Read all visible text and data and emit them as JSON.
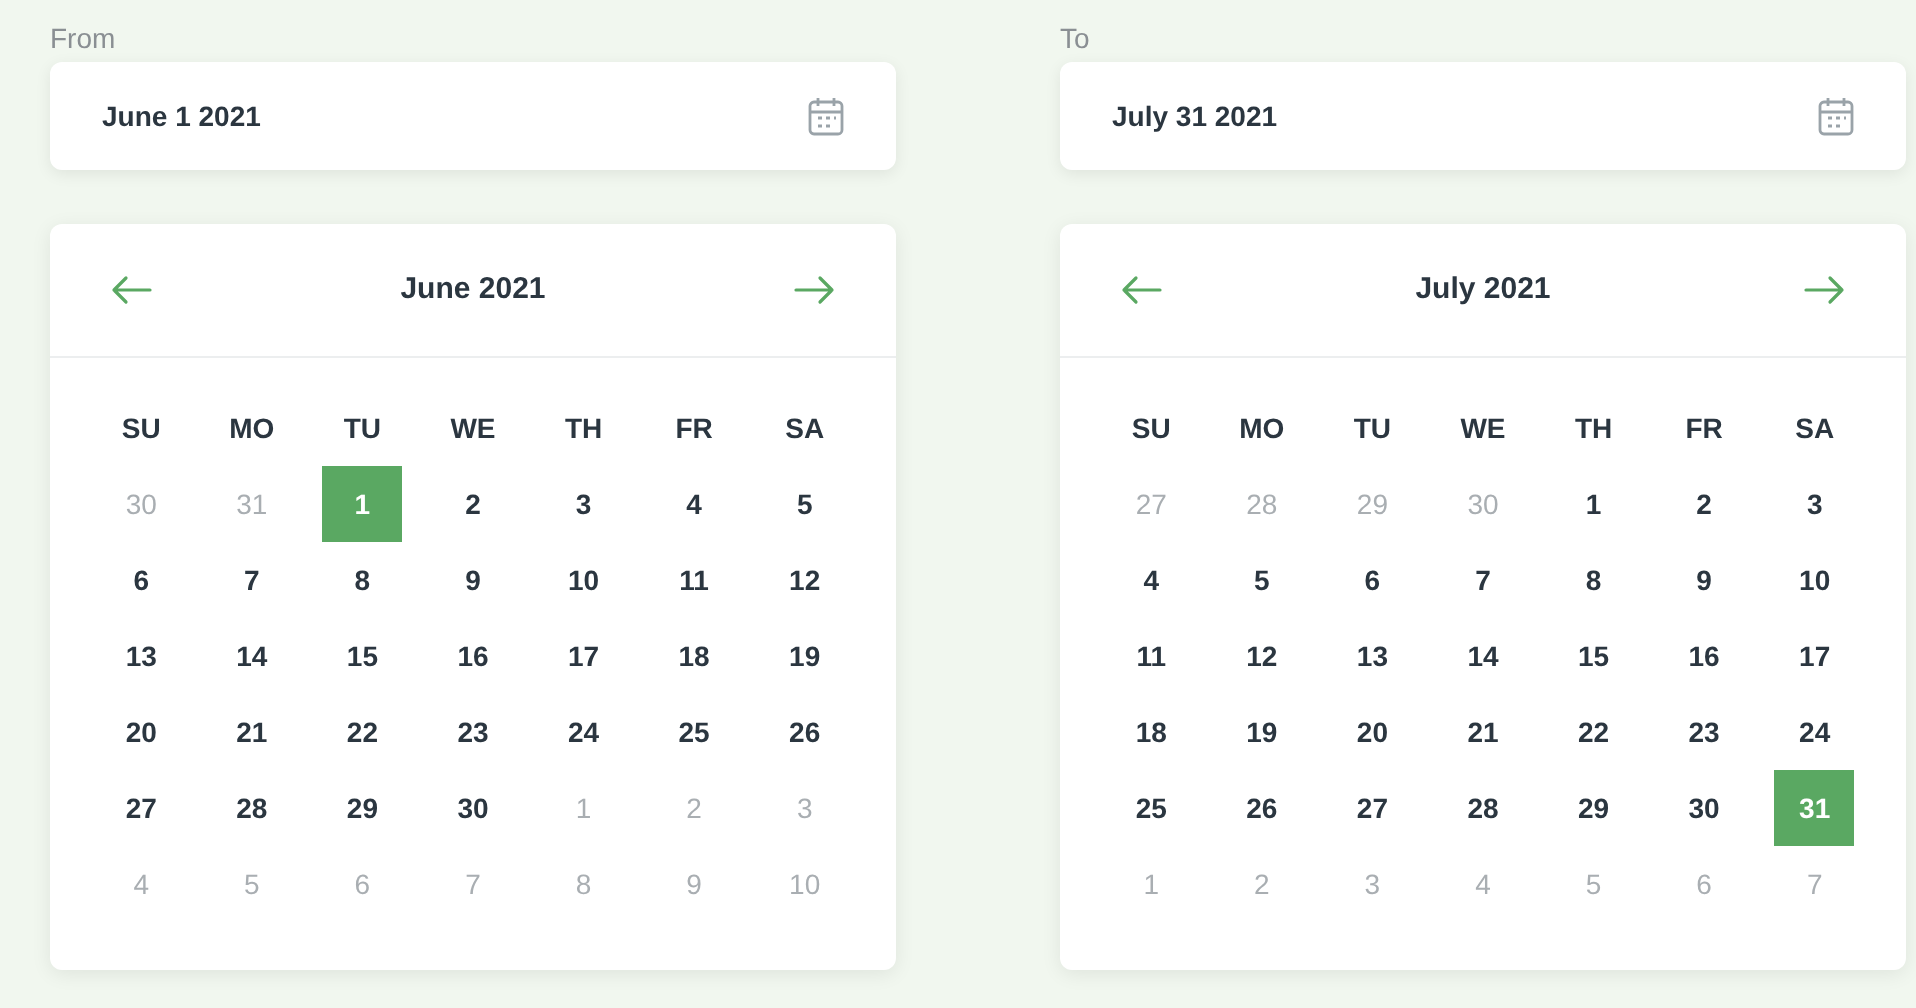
{
  "pickers": [
    {
      "label": "From",
      "value": "June 1 2021",
      "month": "June 2021",
      "weekdays": [
        "SU",
        "MO",
        "TU",
        "WE",
        "TH",
        "FR",
        "SA"
      ],
      "weeks": [
        [
          {
            "text": "30",
            "muted": true,
            "selected": false
          },
          {
            "text": "31",
            "muted": true,
            "selected": false
          },
          {
            "text": "1",
            "muted": false,
            "selected": true
          },
          {
            "text": "2",
            "muted": false,
            "selected": false
          },
          {
            "text": "3",
            "muted": false,
            "selected": false
          },
          {
            "text": "4",
            "muted": false,
            "selected": false
          },
          {
            "text": "5",
            "muted": false,
            "selected": false
          }
        ],
        [
          {
            "text": "6",
            "muted": false,
            "selected": false
          },
          {
            "text": "7",
            "muted": false,
            "selected": false
          },
          {
            "text": "8",
            "muted": false,
            "selected": false
          },
          {
            "text": "9",
            "muted": false,
            "selected": false
          },
          {
            "text": "10",
            "muted": false,
            "selected": false
          },
          {
            "text": "11",
            "muted": false,
            "selected": false
          },
          {
            "text": "12",
            "muted": false,
            "selected": false
          }
        ],
        [
          {
            "text": "13",
            "muted": false,
            "selected": false
          },
          {
            "text": "14",
            "muted": false,
            "selected": false
          },
          {
            "text": "15",
            "muted": false,
            "selected": false
          },
          {
            "text": "16",
            "muted": false,
            "selected": false
          },
          {
            "text": "17",
            "muted": false,
            "selected": false
          },
          {
            "text": "18",
            "muted": false,
            "selected": false
          },
          {
            "text": "19",
            "muted": false,
            "selected": false
          }
        ],
        [
          {
            "text": "20",
            "muted": false,
            "selected": false
          },
          {
            "text": "21",
            "muted": false,
            "selected": false
          },
          {
            "text": "22",
            "muted": false,
            "selected": false
          },
          {
            "text": "23",
            "muted": false,
            "selected": false
          },
          {
            "text": "24",
            "muted": false,
            "selected": false
          },
          {
            "text": "25",
            "muted": false,
            "selected": false
          },
          {
            "text": "26",
            "muted": false,
            "selected": false
          }
        ],
        [
          {
            "text": "27",
            "muted": false,
            "selected": false
          },
          {
            "text": "28",
            "muted": false,
            "selected": false
          },
          {
            "text": "29",
            "muted": false,
            "selected": false
          },
          {
            "text": "30",
            "muted": false,
            "selected": false
          },
          {
            "text": "1",
            "muted": true,
            "selected": false
          },
          {
            "text": "2",
            "muted": true,
            "selected": false
          },
          {
            "text": "3",
            "muted": true,
            "selected": false
          }
        ],
        [
          {
            "text": "4",
            "muted": true,
            "selected": false
          },
          {
            "text": "5",
            "muted": true,
            "selected": false
          },
          {
            "text": "6",
            "muted": true,
            "selected": false
          },
          {
            "text": "7",
            "muted": true,
            "selected": false
          },
          {
            "text": "8",
            "muted": true,
            "selected": false
          },
          {
            "text": "9",
            "muted": true,
            "selected": false
          },
          {
            "text": "10",
            "muted": true,
            "selected": false
          }
        ]
      ]
    },
    {
      "label": "To",
      "value": "July 31 2021",
      "month": "July 2021",
      "weekdays": [
        "SU",
        "MO",
        "TU",
        "WE",
        "TH",
        "FR",
        "SA"
      ],
      "weeks": [
        [
          {
            "text": "27",
            "muted": true,
            "selected": false
          },
          {
            "text": "28",
            "muted": true,
            "selected": false
          },
          {
            "text": "29",
            "muted": true,
            "selected": false
          },
          {
            "text": "30",
            "muted": true,
            "selected": false
          },
          {
            "text": "1",
            "muted": false,
            "selected": false
          },
          {
            "text": "2",
            "muted": false,
            "selected": false
          },
          {
            "text": "3",
            "muted": false,
            "selected": false
          }
        ],
        [
          {
            "text": "4",
            "muted": false,
            "selected": false
          },
          {
            "text": "5",
            "muted": false,
            "selected": false
          },
          {
            "text": "6",
            "muted": false,
            "selected": false
          },
          {
            "text": "7",
            "muted": false,
            "selected": false
          },
          {
            "text": "8",
            "muted": false,
            "selected": false
          },
          {
            "text": "9",
            "muted": false,
            "selected": false
          },
          {
            "text": "10",
            "muted": false,
            "selected": false
          }
        ],
        [
          {
            "text": "11",
            "muted": false,
            "selected": false
          },
          {
            "text": "12",
            "muted": false,
            "selected": false
          },
          {
            "text": "13",
            "muted": false,
            "selected": false
          },
          {
            "text": "14",
            "muted": false,
            "selected": false
          },
          {
            "text": "15",
            "muted": false,
            "selected": false
          },
          {
            "text": "16",
            "muted": false,
            "selected": false
          },
          {
            "text": "17",
            "muted": false,
            "selected": false
          }
        ],
        [
          {
            "text": "18",
            "muted": false,
            "selected": false
          },
          {
            "text": "19",
            "muted": false,
            "selected": false
          },
          {
            "text": "20",
            "muted": false,
            "selected": false
          },
          {
            "text": "21",
            "muted": false,
            "selected": false
          },
          {
            "text": "22",
            "muted": false,
            "selected": false
          },
          {
            "text": "23",
            "muted": false,
            "selected": false
          },
          {
            "text": "24",
            "muted": false,
            "selected": false
          }
        ],
        [
          {
            "text": "25",
            "muted": false,
            "selected": false
          },
          {
            "text": "26",
            "muted": false,
            "selected": false
          },
          {
            "text": "27",
            "muted": false,
            "selected": false
          },
          {
            "text": "28",
            "muted": false,
            "selected": false
          },
          {
            "text": "29",
            "muted": false,
            "selected": false
          },
          {
            "text": "30",
            "muted": false,
            "selected": false
          },
          {
            "text": "31",
            "muted": false,
            "selected": true
          }
        ],
        [
          {
            "text": "1",
            "muted": true,
            "selected": false
          },
          {
            "text": "2",
            "muted": true,
            "selected": false
          },
          {
            "text": "3",
            "muted": true,
            "selected": false
          },
          {
            "text": "4",
            "muted": true,
            "selected": false
          },
          {
            "text": "5",
            "muted": true,
            "selected": false
          },
          {
            "text": "6",
            "muted": true,
            "selected": false
          },
          {
            "text": "7",
            "muted": true,
            "selected": false
          }
        ]
      ]
    }
  ]
}
